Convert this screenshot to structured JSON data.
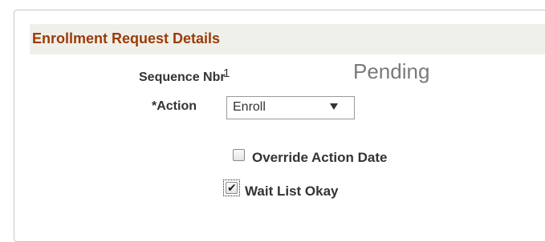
{
  "section": {
    "title": "Enrollment Request Details"
  },
  "sequence": {
    "label": "Sequence Nbr",
    "value": "1",
    "status": "Pending"
  },
  "action": {
    "label": "*Action",
    "selected": "Enroll"
  },
  "options": {
    "override_action_date": {
      "label": "Override Action Date",
      "checked": false
    },
    "wait_list_okay": {
      "label": "Wait List Okay",
      "checked": true
    }
  },
  "icons": {
    "dropdown": "chevron-down-icon",
    "check": "check-icon"
  },
  "colors": {
    "header_text": "#9c3b06",
    "header_bg": "#f0f0eb",
    "status_text": "#7a7a7a"
  }
}
